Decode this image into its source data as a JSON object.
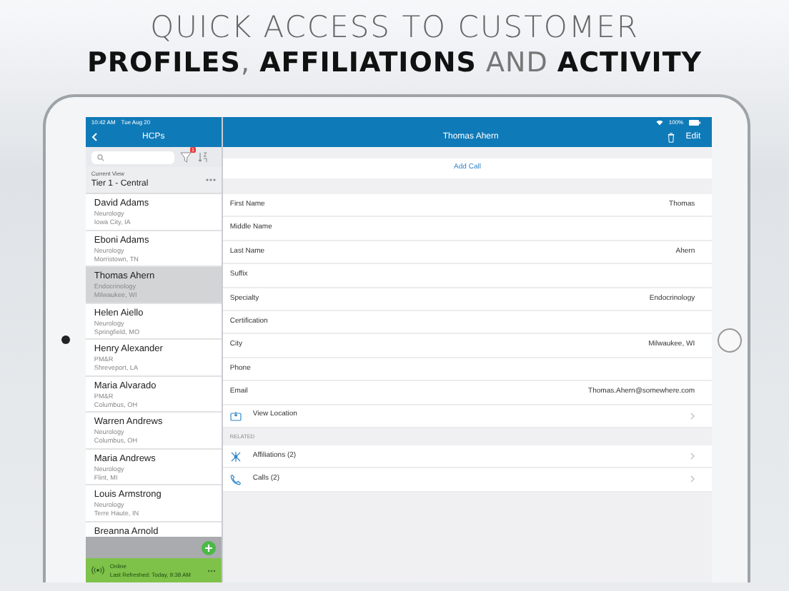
{
  "headline": {
    "line_1": "QUICK ACCESS TO CUSTOMER",
    "line_2": "**PROFILES**, **AFFILIATIONS** AND **ACTIVITY**"
  },
  "master": {
    "status_time": "10:42 AM",
    "status_date": "Tue Aug 20",
    "title": "HCPs",
    "filter_badge": "1",
    "current_view_label": "Current View",
    "current_view_value": "Tier 1 - Central",
    "hcps": [
      {
        "name": "David Adams",
        "specialty": "Neurology",
        "location": "Iowa City, IA",
        "selected": false
      },
      {
        "name": "Eboni Adams",
        "specialty": "Neurology",
        "location": "Morristown, TN",
        "selected": false
      },
      {
        "name": "Thomas Ahern",
        "specialty": "Endocrinology",
        "location": "Milwaukee, WI",
        "selected": true
      },
      {
        "name": "Helen Aiello",
        "specialty": "Neurology",
        "location": "Springfield, MO",
        "selected": false
      },
      {
        "name": "Henry Alexander",
        "specialty": "PM&R",
        "location": "Shreveport, LA",
        "selected": false
      },
      {
        "name": "Maria Alvarado",
        "specialty": "PM&R",
        "location": "Columbus, OH",
        "selected": false
      },
      {
        "name": "Warren Andrews",
        "specialty": "Neurology",
        "location": "Columbus, OH",
        "selected": false
      },
      {
        "name": "Maria Andrews",
        "specialty": "Neurology",
        "location": "Flint, MI",
        "selected": false
      },
      {
        "name": "Louis Armstrong",
        "specialty": "Neurology",
        "location": "Terre Haute, IN",
        "selected": false
      },
      {
        "name": "Breanna Arnold",
        "selected": false
      }
    ],
    "connection": {
      "status": "Online",
      "last_refreshed": "Last Refreshed: Today, 9:38 AM"
    }
  },
  "detail": {
    "battery": "100%",
    "title": "Thomas Ahern",
    "edit": "Edit",
    "add_call": "Add Call",
    "fields": [
      {
        "label": "First Name",
        "value": "Thomas"
      },
      {
        "label": "Middle Name"
      },
      {
        "label": "Last Name",
        "value": "Ahern"
      },
      {
        "label": "Suffix"
      },
      {
        "label": "Specialty",
        "value": "Endocrinology"
      },
      {
        "label": "Certification"
      },
      {
        "label": "City",
        "value": "Milwaukee, WI"
      },
      {
        "label": "Phone"
      },
      {
        "label": "Email",
        "value": "Thomas.Ahern@somewhere.com"
      }
    ],
    "view_location": "View Location",
    "related_header": "RELATED",
    "related": [
      {
        "kind": "affiliations",
        "label": "Affiliations (2)"
      },
      {
        "kind": "calls",
        "label": "Calls (2)"
      }
    ]
  }
}
